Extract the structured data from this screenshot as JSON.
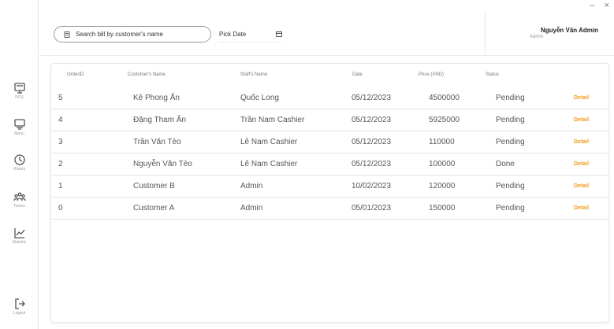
{
  "window": {
    "minimize": "–",
    "close": "×"
  },
  "sidebar": {
    "items": [
      {
        "label": "POS",
        "icon": "pos-icon"
      },
      {
        "label": "Menu",
        "icon": "menu-icon"
      },
      {
        "label": "History",
        "icon": "history-icon"
      },
      {
        "label": "Teams",
        "icon": "teams-icon"
      },
      {
        "label": "Statistic",
        "icon": "statistic-icon"
      }
    ],
    "logout": {
      "label": "Logout",
      "icon": "logout-icon"
    }
  },
  "header": {
    "search_placeholder": "Search bill by customer's name",
    "date_label": "Pick Date",
    "user_name": "Nguyễn Văn Admin",
    "user_role": "Admin"
  },
  "table": {
    "columns": [
      "OrderID",
      "Customer's Name",
      "Staff's Name",
      "Date",
      "Price (VND)",
      "Status"
    ],
    "detail_label": "Detail",
    "accent_color": "#f39a1e",
    "rows": [
      {
        "id": "5",
        "customer": "Kê Phong Ẩn",
        "staff": "Quốc Long",
        "date": "05/12/2023",
        "price": "4500000",
        "status": "Pending"
      },
      {
        "id": "4",
        "customer": "Đặng Tham Ăn",
        "staff": "Trần Nam Cashier",
        "date": "05/12/2023",
        "price": "5925000",
        "status": "Pending"
      },
      {
        "id": "3",
        "customer": "Trần Văn Tèo",
        "staff": "Lê Nam Cashier",
        "date": "05/12/2023",
        "price": "110000",
        "status": "Pending"
      },
      {
        "id": "2",
        "customer": "Nguyễn Văn Tèo",
        "staff": "Lê Nam Cashier",
        "date": "05/12/2023",
        "price": "100000",
        "status": "Done"
      },
      {
        "id": "1",
        "customer": "Customer B",
        "staff": "Admin",
        "date": "10/02/2023",
        "price": "120000",
        "status": "Pending"
      },
      {
        "id": "0",
        "customer": "Customer A",
        "staff": "Admin",
        "date": "05/01/2023",
        "price": "150000",
        "status": "Pending"
      }
    ]
  }
}
